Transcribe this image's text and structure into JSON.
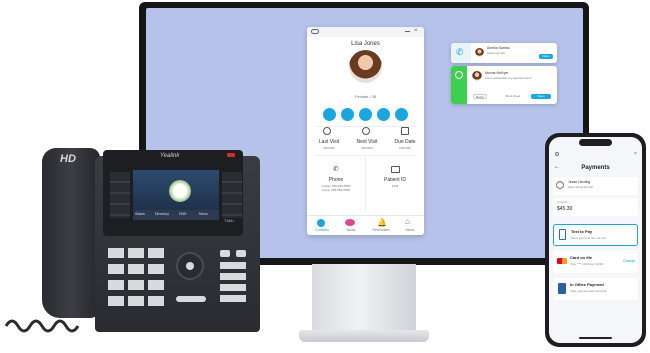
{
  "desktop_app": {
    "contact_name": "Lisa Jones",
    "contact_subtitle": "Female / 38",
    "quick_actions": [
      "call-icon",
      "message-icon",
      "email-icon",
      "document-icon",
      "payment-icon"
    ],
    "fields": [
      {
        "label": "Last Visit",
        "value": "5/4/2023"
      },
      {
        "label": "Next Visit",
        "value": "5/5/2023"
      },
      {
        "label": "Due Date",
        "value": "6/4/2023"
      }
    ],
    "phone": {
      "label": "Phone",
      "lines": [
        "mobile: 555-555-5555",
        "home: 555-555-5555"
      ]
    },
    "patient_id": {
      "label": "Patient ID",
      "value": "1234"
    },
    "nav": [
      "Contacts",
      "News",
      "Reminders",
      "Menu"
    ]
  },
  "notifications": {
    "call": {
      "name": "Amelia Santos",
      "detail": "Incoming call",
      "button": "Open"
    },
    "sms": {
      "name": "Norma McKyer",
      "message": "Can I reschedule my appointment?",
      "buttons": [
        "Reply",
        "Mark Read",
        "Open"
      ]
    }
  },
  "desk_phone": {
    "brand": "Yealink",
    "hd_badge": "HD",
    "model": "T46U",
    "softkeys": [
      "Status",
      "Directory",
      "DND",
      "Menu"
    ]
  },
  "mobile": {
    "title": "Payments",
    "customer_name": "Jesse Harding",
    "customer_detail": "Main Street Dental",
    "amount_label": "Amount",
    "amount": "$45.30",
    "options": [
      {
        "title": "Text to Pay",
        "detail": "Send payment link via text",
        "icon": "phone-icon"
      },
      {
        "title": "Card on file",
        "detail": "Visa **** 1234 Exp 10/25",
        "action": "Change",
        "icon": "card-icon"
      },
      {
        "title": "In Office Payment",
        "detail": "Take payment with terminal",
        "icon": "terminal-icon"
      }
    ]
  }
}
